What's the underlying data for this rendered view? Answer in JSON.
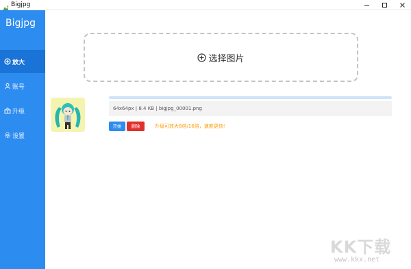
{
  "window": {
    "title": "Bigjpg"
  },
  "sidebar": {
    "brand": "Bigjpg",
    "items": [
      {
        "label": "放大",
        "icon": "plus-circle-icon",
        "active": true
      },
      {
        "label": "账号",
        "icon": "user-icon",
        "active": false
      },
      {
        "label": "升级",
        "icon": "upgrade-icon",
        "active": false
      },
      {
        "label": "设置",
        "icon": "gear-icon",
        "active": false
      }
    ]
  },
  "main": {
    "select_label": "选择图片",
    "file": {
      "info": "64x64px | 8.4 KB | bigjpg_00001.png"
    },
    "start_label": "开始",
    "delete_label": "删除",
    "upgrade_note": "升级可放大8倍/16倍，速度更快!"
  },
  "watermark": {
    "logo": "KK下载",
    "url": "www.kkx.net"
  },
  "colors": {
    "sidebar": "#2d8cf0",
    "sidebar_active": "#1a73d6",
    "start_button": "#2d8cf0",
    "delete_button": "#e0302c",
    "note": "#ff9900"
  }
}
